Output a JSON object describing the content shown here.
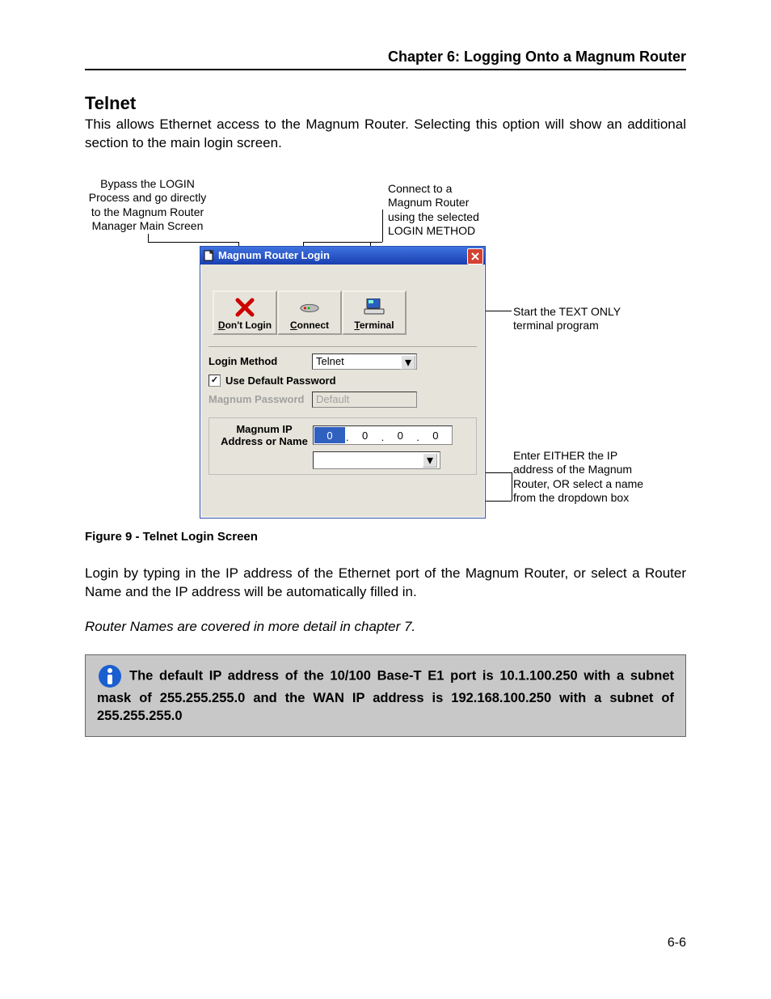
{
  "header": {
    "chapter": "Chapter 6: Logging Onto a Magnum Router"
  },
  "section": {
    "title": "Telnet",
    "intro": "This allows Ethernet access to the Magnum Router.  Selecting this option will show an additional section to the main login screen."
  },
  "figure": {
    "caption": "Figure 9 - Telnet Login Screen",
    "callouts": {
      "bypass": "Bypass the LOGIN Process and go directly to the Magnum Router Manager Main Screen",
      "connect": "Connect to a Magnum Router using the selected LOGIN METHOD",
      "terminal": "Start the TEXT ONLY terminal program",
      "ip": "Enter EITHER the IP address of the Magnum Router, OR select a name from the dropdown box"
    },
    "dialog": {
      "title": "Magnum Router Login",
      "buttons": {
        "dont_login": {
          "accel": "D",
          "rest": "on't Login"
        },
        "connect": {
          "accel": "C",
          "rest": "onnect"
        },
        "terminal": {
          "accel": "T",
          "rest": "erminal"
        }
      },
      "login_method_label": "Login Method",
      "login_method_value": "Telnet",
      "use_default_pw_label": "Use Default Password",
      "use_default_pw_checked": "✓",
      "password_label": "Magnum Password",
      "password_value": "Default",
      "ip_label": "Magnum IP Address or Name",
      "ip_octets": [
        "0",
        "0",
        "0",
        "0"
      ]
    }
  },
  "after_figure": {
    "p1": "Login by typing in the IP address of the Ethernet port of the Magnum Router, or select a Router Name and the IP address will be automatically filled in.",
    "p2_italic": "Router Names are covered in more detail in chapter 7."
  },
  "infobox": {
    "text": "The default IP address of the 10/100 Base-T E1 port is 10.1.100.250 with a subnet mask of 255.255.255.0 and the WAN IP address is 192.168.100.250 with a subnet of 255.255.255.0"
  },
  "page_number": "6-6"
}
